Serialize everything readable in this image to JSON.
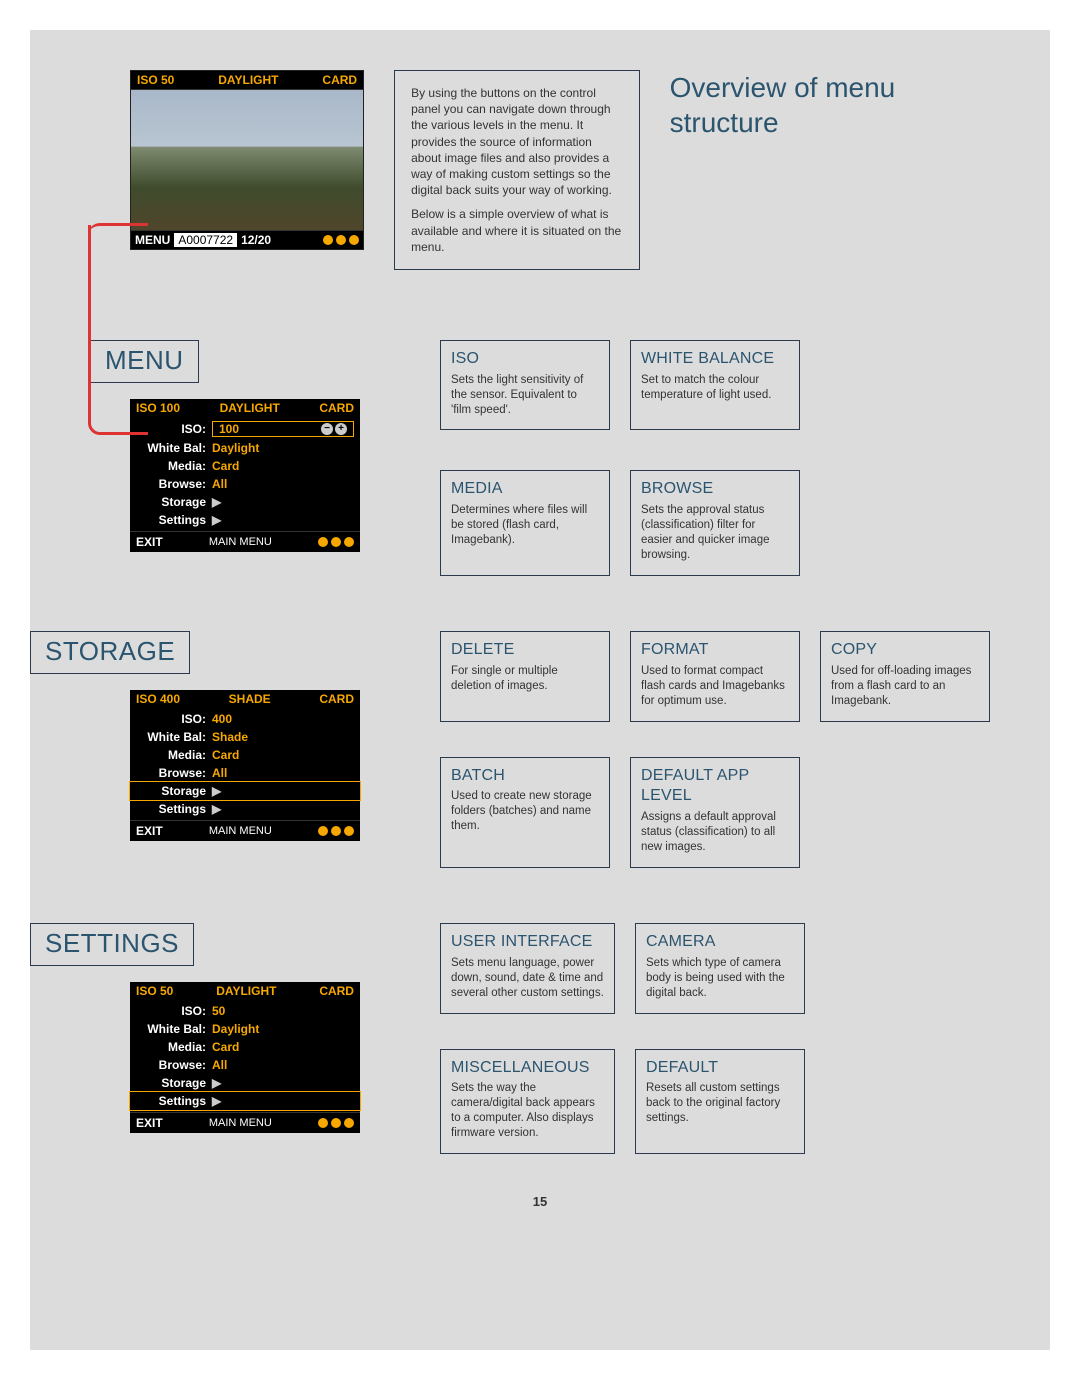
{
  "title": "Overview of menu structure",
  "intro": {
    "p1": "By using the buttons on the control panel you can navigate down through the various levels in the menu. It provides the source of information about image files and also provides a way of making custom settings so the digital back suits your way of working.",
    "p2": "Below is a simple overview of what is available and where it is situated on the menu."
  },
  "lcd_top": {
    "iso": "ISO 50",
    "wb": "DAYLIGHT",
    "media": "CARD",
    "menu": "MENU",
    "file": "A0007722",
    "counter": "12/20"
  },
  "menu_section": {
    "title": "MENU",
    "lcd": {
      "iso_top": "ISO 100",
      "wb_top": "DAYLIGHT",
      "media_top": "CARD",
      "rows": {
        "iso_lbl": "ISO:",
        "iso_val": "100",
        "wb_lbl": "White Bal:",
        "wb_val": "Daylight",
        "media_lbl": "Media:",
        "media_val": "Card",
        "browse_lbl": "Browse:",
        "browse_val": "All",
        "storage_lbl": "Storage",
        "settings_lbl": "Settings"
      },
      "exit": "EXIT",
      "footer_center": "MAIN MENU"
    },
    "cards": {
      "iso_h": "ISO",
      "iso_d": "Sets the light sensitivity of the sensor. Equivalent to 'film speed'.",
      "wb_h": "WHITE BALANCE",
      "wb_d": "Set to match the colour temperature of light used.",
      "media_h": "MEDIA",
      "media_d": "Determines where files will be stored (flash card, Imagebank).",
      "browse_h": "BROWSE",
      "browse_d": "Sets the approval status (classification) filter for easier and quicker image browsing."
    }
  },
  "storage_section": {
    "title": "STORAGE",
    "lcd": {
      "iso_top": "ISO 400",
      "wb_top": "SHADE",
      "media_top": "CARD",
      "rows": {
        "iso_lbl": "ISO:",
        "iso_val": "400",
        "wb_lbl": "White Bal:",
        "wb_val": "Shade",
        "media_lbl": "Media:",
        "media_val": "Card",
        "browse_lbl": "Browse:",
        "browse_val": "All",
        "storage_lbl": "Storage",
        "settings_lbl": "Settings"
      },
      "exit": "EXIT",
      "footer_center": "MAIN MENU"
    },
    "cards": {
      "delete_h": "DELETE",
      "delete_d": "For single or multiple deletion of images.",
      "format_h": "FORMAT",
      "format_d": "Used to format compact flash cards and Imagebanks for optimum use.",
      "copy_h": "COPY",
      "copy_d": "Used for off-loading images from a flash card to an Imagebank.",
      "batch_h": "BATCH",
      "batch_d": "Used to create new storage folders (batches) and name them.",
      "default_h": "DEFAULT APP LEVEL",
      "default_d": "Assigns a default approval status (classification) to all new images."
    }
  },
  "settings_section": {
    "title": "SETTINGS",
    "lcd": {
      "iso_top": "ISO 50",
      "wb_top": "DAYLIGHT",
      "media_top": "CARD",
      "rows": {
        "iso_lbl": "ISO:",
        "iso_val": "50",
        "wb_lbl": "White Bal:",
        "wb_val": "Daylight",
        "media_lbl": "Media:",
        "media_val": "Card",
        "browse_lbl": "Browse:",
        "browse_val": "All",
        "storage_lbl": "Storage",
        "settings_lbl": "Settings"
      },
      "exit": "EXIT",
      "footer_center": "MAIN MENU"
    },
    "cards": {
      "ui_h": "USER INTERFACE",
      "ui_d": "Sets menu language, power down, sound, date & time and several other custom settings.",
      "camera_h": "CAMERA",
      "camera_d": "Sets which type of camera body is being used with the digital back.",
      "misc_h": "MISCELLANEOUS",
      "misc_d": "Sets the way the camera/digital back appears to a computer. Also displays firmware version.",
      "default_h": "DEFAULT",
      "default_d": "Resets all custom settings back to the original factory settings."
    }
  },
  "page_number": "15",
  "glyphs": {
    "arrow": "▶",
    "minus": "−",
    "plus": "+"
  }
}
